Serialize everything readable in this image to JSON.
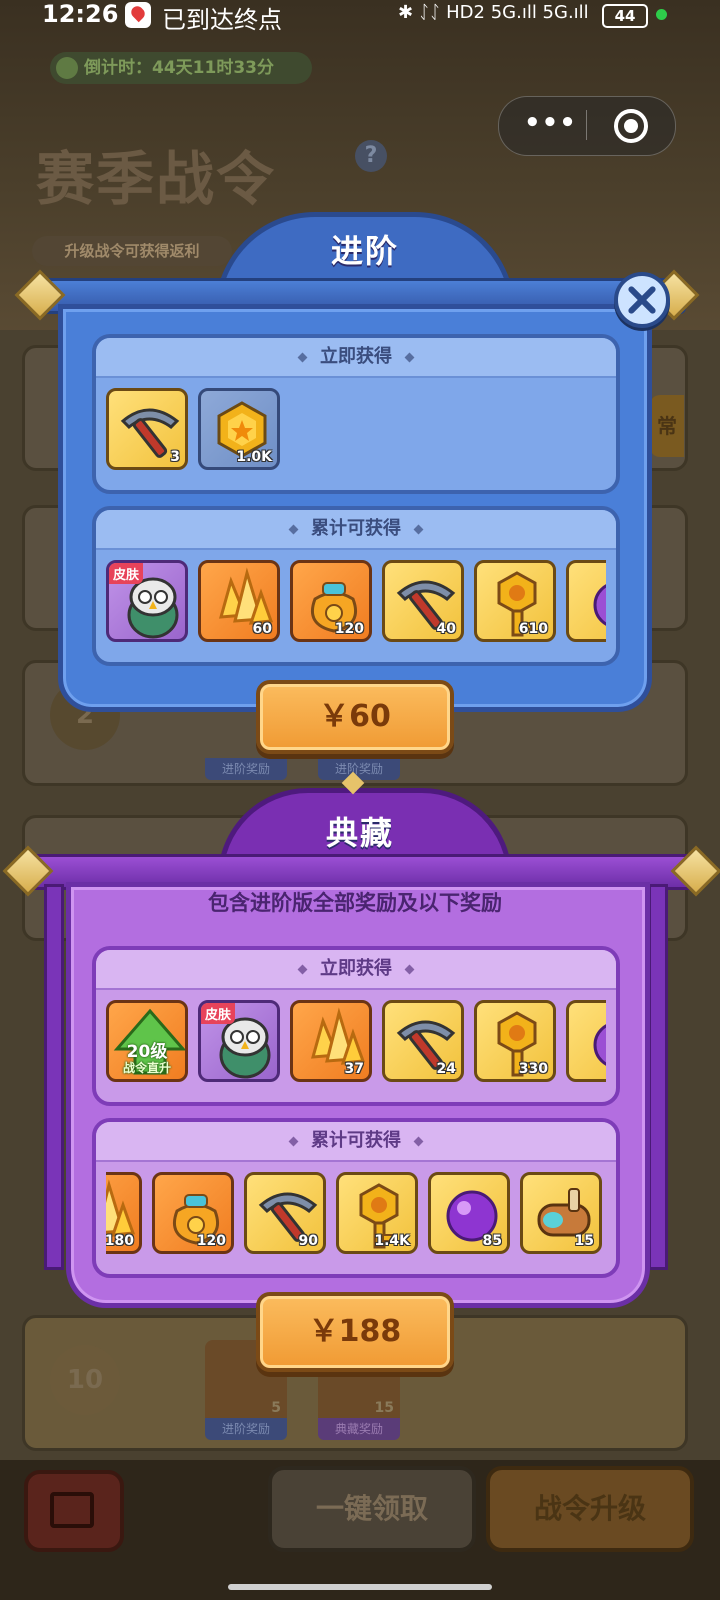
{
  "status_bar": {
    "time": "12:26",
    "notification": "已到达终点",
    "indicators": "✱ ᛇᛇ HD2 5G.ıll 5G.ıll",
    "battery": "44"
  },
  "background": {
    "countdown": "倒计时：44天11时33分",
    "season_title": "赛季战令",
    "help": "?",
    "upgrade_hint": "升级战令可获得返利",
    "level_badges": [
      "2",
      "10"
    ],
    "reward_tags": [
      "进阶奖励",
      "进阶奖励",
      "进阶奖励",
      "典藏奖励"
    ],
    "bottom_counts": [
      "5",
      "15"
    ],
    "buttons": {
      "claim_all": "一键领取",
      "upgrade": "战令升级"
    }
  },
  "capsule": {
    "more": "•••"
  },
  "advanced": {
    "title": "进阶",
    "instant_header": "立即获得",
    "cumulative_header": "累计可获得",
    "instant_items": [
      {
        "icon": "pickaxe-icon",
        "count": "3",
        "bg": "gold"
      },
      {
        "icon": "coin-icon",
        "count": "1.0K",
        "bg": "blue"
      }
    ],
    "cumulative_items": [
      {
        "icon": "owl-skin-icon",
        "count": "",
        "tag": "皮肤",
        "bg": "purple"
      },
      {
        "icon": "crystal-icon",
        "count": "60",
        "bg": "orange"
      },
      {
        "icon": "lucky-bag-icon",
        "count": "120",
        "bg": "orange"
      },
      {
        "icon": "pickaxe-icon",
        "count": "40",
        "bg": "gold"
      },
      {
        "icon": "key-icon",
        "count": "610",
        "bg": "gold"
      },
      {
        "icon": "orb-icon",
        "count": "",
        "bg": "gold"
      }
    ],
    "price": "￥60"
  },
  "collector": {
    "title": "典藏",
    "subtitle": "包含进阶版全部奖励及以下奖励",
    "instant_header": "立即获得",
    "cumulative_header": "累计可获得",
    "instant_items": [
      {
        "icon": "level-up-arrow-icon",
        "count": "",
        "label_top": "20级",
        "label_bottom": "战令直升",
        "bg": "orange"
      },
      {
        "icon": "owl-skin-icon",
        "count": "",
        "tag": "皮肤",
        "bg": "purple"
      },
      {
        "icon": "crystal-icon",
        "count": "37",
        "bg": "orange"
      },
      {
        "icon": "pickaxe-icon",
        "count": "24",
        "bg": "gold"
      },
      {
        "icon": "key-icon",
        "count": "330",
        "bg": "gold"
      },
      {
        "icon": "orb-icon",
        "count": "",
        "bg": "gold"
      }
    ],
    "cumulative_items": [
      {
        "icon": "crystal-icon",
        "count": "180",
        "bg": "orange"
      },
      {
        "icon": "lucky-bag-icon",
        "count": "120",
        "bg": "orange"
      },
      {
        "icon": "pickaxe-icon",
        "count": "90",
        "bg": "gold"
      },
      {
        "icon": "key-icon",
        "count": "1.4K",
        "bg": "gold"
      },
      {
        "icon": "purple-orb-icon",
        "count": "85",
        "bg": "gold"
      },
      {
        "icon": "scroll-icon",
        "count": "15",
        "bg": "gold"
      }
    ],
    "price": "￥188"
  },
  "colors": {
    "advanced_panel": "#4a7fd8",
    "collector_panel": "#b36ee0",
    "price_button": "#f09a33"
  }
}
